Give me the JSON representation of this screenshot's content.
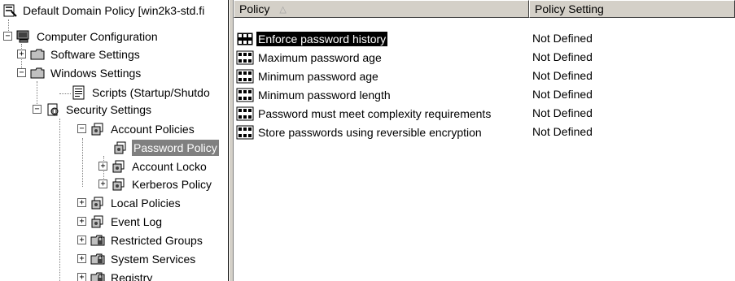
{
  "tree": {
    "root": {
      "label": "Default Domain Policy [win2k3-std.fi",
      "icon": "policy-root-icon"
    },
    "items": [
      {
        "label": "Computer Configuration",
        "icon": "computer-icon",
        "expander": "−"
      },
      {
        "label": "Software Settings",
        "icon": "folder-icon",
        "expander": "+"
      },
      {
        "label": "Windows Settings",
        "icon": "folder-icon",
        "expander": "−"
      },
      {
        "label": "Scripts (Startup/Shutdo",
        "icon": "scripts-icon",
        "expander": ""
      },
      {
        "label": "Security Settings",
        "icon": "security-settings-icon",
        "expander": "−"
      },
      {
        "label": "Account Policies",
        "icon": "policies-icon",
        "expander": "−"
      },
      {
        "label": "Password Policy",
        "icon": "policies-icon",
        "expander": ""
      },
      {
        "label": "Account Locko",
        "icon": "policies-icon",
        "expander": "+"
      },
      {
        "label": "Kerberos Policy",
        "icon": "policies-icon",
        "expander": "+"
      },
      {
        "label": "Local Policies",
        "icon": "policies-icon",
        "expander": "+"
      },
      {
        "label": "Event Log",
        "icon": "policies-icon",
        "expander": "+"
      },
      {
        "label": "Restricted Groups",
        "icon": "lock-folder-icon",
        "expander": "+"
      },
      {
        "label": "System Services",
        "icon": "lock-folder-icon",
        "expander": "+"
      },
      {
        "label": "Registry",
        "icon": "lock-folder-icon",
        "expander": "+"
      }
    ]
  },
  "list": {
    "columns": [
      {
        "label": "Policy",
        "sort_indicator": "△"
      },
      {
        "label": "Policy Setting"
      }
    ],
    "rows": [
      {
        "policy": "Enforce password history",
        "setting": "Not Defined",
        "selected": true
      },
      {
        "policy": "Maximum password age",
        "setting": "Not Defined"
      },
      {
        "policy": "Minimum password age",
        "setting": "Not Defined"
      },
      {
        "policy": "Minimum password length",
        "setting": "Not Defined"
      },
      {
        "policy": "Password must meet complexity requirements",
        "setting": "Not Defined"
      },
      {
        "policy": "Store passwords using reversible encryption",
        "setting": "Not Defined"
      }
    ]
  },
  "colors": {
    "selection": "#000000",
    "tree_selection": "#808080",
    "chrome": "#d4d0c8"
  }
}
